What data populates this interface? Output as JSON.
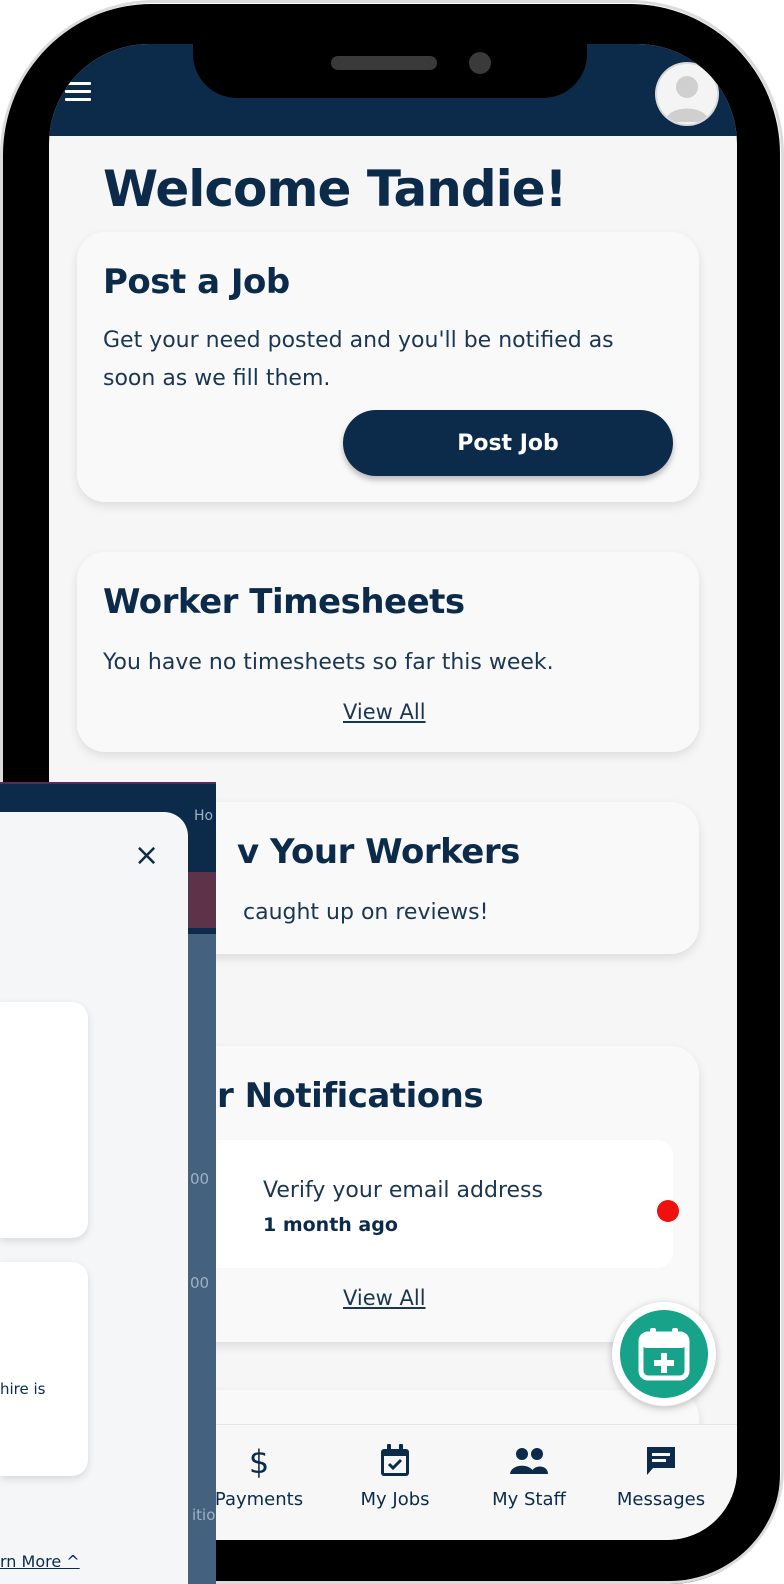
{
  "welcome": "Welcome Tandie!",
  "post_job_card": {
    "title": "Post a Job",
    "description": "Get your need posted and you'll be notified as soon as we fill them.",
    "button_label": "Post Job"
  },
  "timesheets_card": {
    "title": "Worker Timesheets",
    "description": "You have no timesheets so far this week.",
    "link": "View All"
  },
  "review_card": {
    "title": "v Your Workers",
    "description": "caught up on reviews!"
  },
  "notifications_card": {
    "title": "r Notifications",
    "item": {
      "title": "Verify your email address",
      "time": "1 month ago"
    },
    "link": "View All"
  },
  "bottom_nav": {
    "items": [
      {
        "label": "Payments",
        "icon": "dollar-icon"
      },
      {
        "label": "My Jobs",
        "icon": "calendar-check-icon"
      },
      {
        "label": "My Staff",
        "icon": "people-icon"
      },
      {
        "label": "Messages",
        "icon": "chat-icon"
      }
    ]
  },
  "overlay": {
    "home_label": "Ho",
    "close_glyph": "×",
    "fragment_a": "00",
    "fragment_b": "00",
    "fragment_c": "hire is",
    "fragment_d": "itio",
    "learn_more": "rn More ^"
  },
  "colors": {
    "primary": "#0c2b4a",
    "background": "#f6f6f6",
    "accent_green": "#17a28a",
    "notification_dot": "#f01010"
  }
}
